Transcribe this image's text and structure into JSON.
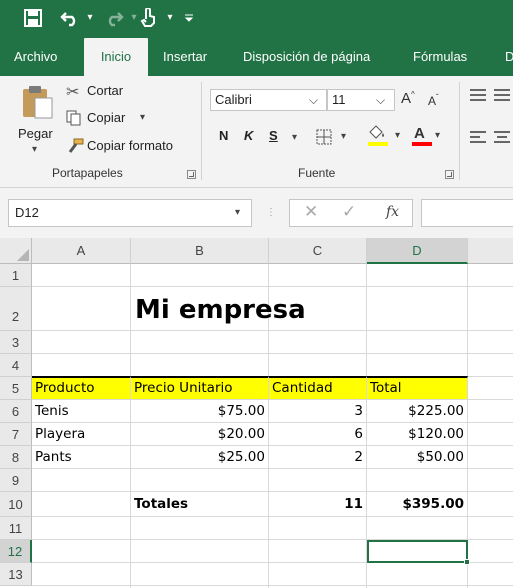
{
  "ribbon_tabs": [
    "Archivo",
    "Inicio",
    "Insertar",
    "Disposición de página",
    "Fórmulas",
    "D"
  ],
  "clipboard": {
    "paste_label": "Pegar",
    "cut_label": "Cortar",
    "copy_label": "Copiar",
    "format_painter_label": "Copiar formato",
    "group_label": "Portapapeles"
  },
  "font": {
    "font_name": "Calibri",
    "font_size": "11",
    "bold_label": "N",
    "italic_label": "K",
    "underline_label": "S",
    "group_label": "Fuente",
    "fill_color": "#ffff00",
    "font_color": "#ff0000"
  },
  "formula_bar": {
    "name_box": "D12",
    "fx_label": "fx",
    "formula": ""
  },
  "sheet": {
    "columns": [
      "A",
      "B",
      "C",
      "D"
    ],
    "selected_column": "D",
    "rows": [
      "1",
      "2",
      "3",
      "4",
      "5",
      "6",
      "7",
      "8",
      "9",
      "10",
      "11",
      "12",
      "13"
    ],
    "selected_row": "12",
    "title": "Mi empresa",
    "headers": {
      "producto": "Producto",
      "precio": "Precio Unitario",
      "cantidad": "Cantidad",
      "total": "Total"
    },
    "header_fill": "#ffff00",
    "items": [
      {
        "producto": "Tenis",
        "precio": "$75.00",
        "cantidad": "3",
        "total": "$225.00"
      },
      {
        "producto": "Playera",
        "precio": "$20.00",
        "cantidad": "6",
        "total": "$120.00"
      },
      {
        "producto": "Pants",
        "precio": "$25.00",
        "cantidad": "2",
        "total": "$50.00"
      }
    ],
    "totals": {
      "label": "Totales",
      "cantidad": "11",
      "total": "$395.00"
    }
  },
  "accent_color": "#217346"
}
